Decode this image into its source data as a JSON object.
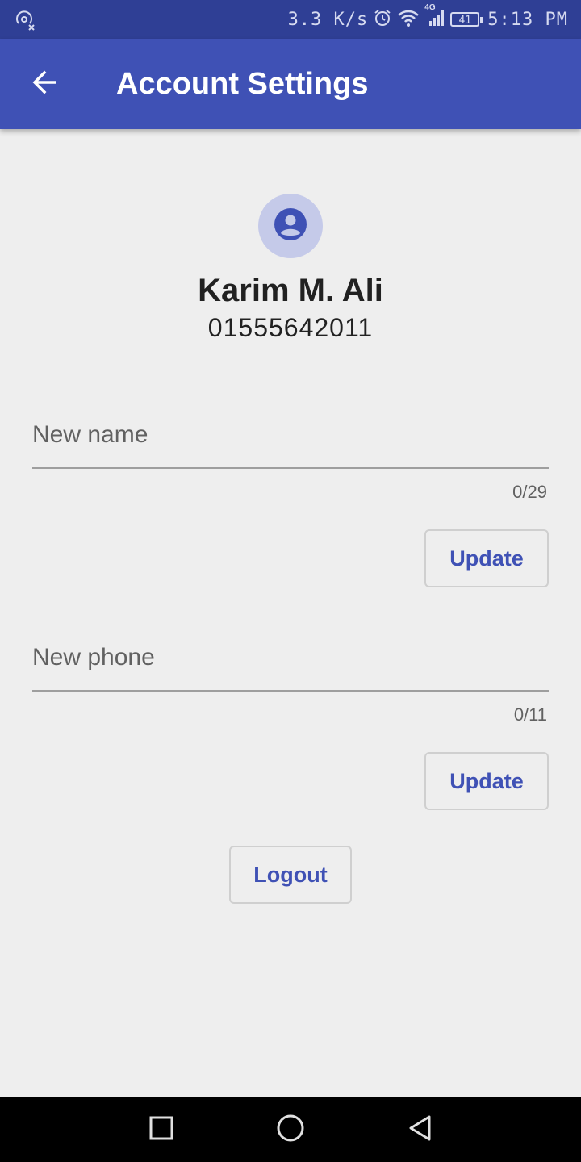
{
  "status_bar": {
    "speed": "3.3 K/s",
    "network": "4G",
    "battery": "41",
    "time": "5:13 PM",
    "icons": [
      "hotspot-icon",
      "alarm-icon",
      "wifi-icon",
      "signal-icon",
      "battery-icon"
    ]
  },
  "app_bar": {
    "title": "Account Settings",
    "back_icon": "arrow-back-icon"
  },
  "profile": {
    "avatar_icon": "account-circle-icon",
    "name": "Karim M. Ali",
    "phone": "01555642011"
  },
  "name_field": {
    "placeholder": "New name",
    "value": "",
    "counter": "0/29",
    "button_label": "Update"
  },
  "phone_field": {
    "placeholder": "New phone",
    "value": "",
    "counter": "0/11",
    "button_label": "Update"
  },
  "logout_label": "Logout",
  "nav_bar": {
    "icons": [
      "recents-square-icon",
      "home-circle-icon",
      "back-triangle-icon"
    ]
  },
  "colors": {
    "status_bar": "#2f3f95",
    "app_bar": "#3f51b5",
    "background": "#eeeeee",
    "accent": "#3f51b5",
    "avatar_bg": "#c5cae9"
  }
}
